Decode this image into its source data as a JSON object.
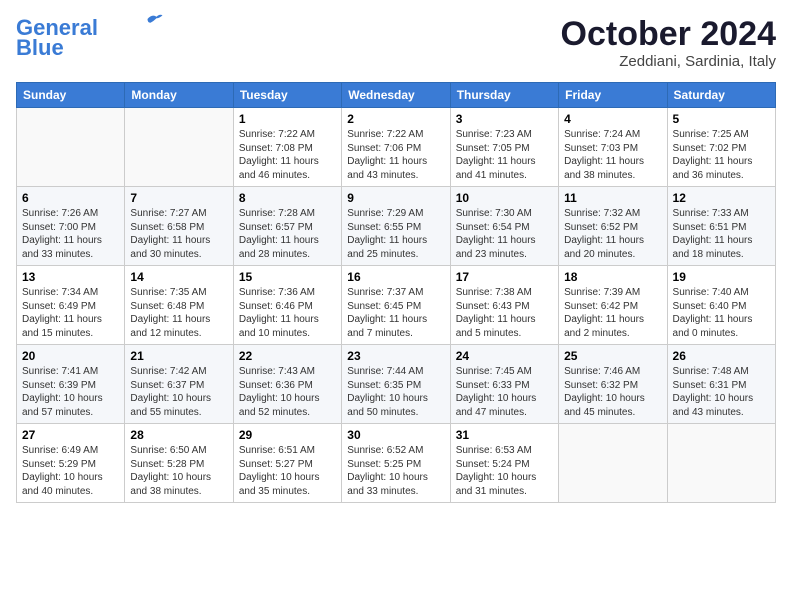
{
  "header": {
    "logo_line1": "General",
    "logo_line2": "Blue",
    "month": "October 2024",
    "location": "Zeddiani, Sardinia, Italy"
  },
  "days_of_week": [
    "Sunday",
    "Monday",
    "Tuesday",
    "Wednesday",
    "Thursday",
    "Friday",
    "Saturday"
  ],
  "weeks": [
    [
      {
        "day": "",
        "info": ""
      },
      {
        "day": "",
        "info": ""
      },
      {
        "day": "1",
        "info": "Sunrise: 7:22 AM\nSunset: 7:08 PM\nDaylight: 11 hours and 46 minutes."
      },
      {
        "day": "2",
        "info": "Sunrise: 7:22 AM\nSunset: 7:06 PM\nDaylight: 11 hours and 43 minutes."
      },
      {
        "day": "3",
        "info": "Sunrise: 7:23 AM\nSunset: 7:05 PM\nDaylight: 11 hours and 41 minutes."
      },
      {
        "day": "4",
        "info": "Sunrise: 7:24 AM\nSunset: 7:03 PM\nDaylight: 11 hours and 38 minutes."
      },
      {
        "day": "5",
        "info": "Sunrise: 7:25 AM\nSunset: 7:02 PM\nDaylight: 11 hours and 36 minutes."
      }
    ],
    [
      {
        "day": "6",
        "info": "Sunrise: 7:26 AM\nSunset: 7:00 PM\nDaylight: 11 hours and 33 minutes."
      },
      {
        "day": "7",
        "info": "Sunrise: 7:27 AM\nSunset: 6:58 PM\nDaylight: 11 hours and 30 minutes."
      },
      {
        "day": "8",
        "info": "Sunrise: 7:28 AM\nSunset: 6:57 PM\nDaylight: 11 hours and 28 minutes."
      },
      {
        "day": "9",
        "info": "Sunrise: 7:29 AM\nSunset: 6:55 PM\nDaylight: 11 hours and 25 minutes."
      },
      {
        "day": "10",
        "info": "Sunrise: 7:30 AM\nSunset: 6:54 PM\nDaylight: 11 hours and 23 minutes."
      },
      {
        "day": "11",
        "info": "Sunrise: 7:32 AM\nSunset: 6:52 PM\nDaylight: 11 hours and 20 minutes."
      },
      {
        "day": "12",
        "info": "Sunrise: 7:33 AM\nSunset: 6:51 PM\nDaylight: 11 hours and 18 minutes."
      }
    ],
    [
      {
        "day": "13",
        "info": "Sunrise: 7:34 AM\nSunset: 6:49 PM\nDaylight: 11 hours and 15 minutes."
      },
      {
        "day": "14",
        "info": "Sunrise: 7:35 AM\nSunset: 6:48 PM\nDaylight: 11 hours and 12 minutes."
      },
      {
        "day": "15",
        "info": "Sunrise: 7:36 AM\nSunset: 6:46 PM\nDaylight: 11 hours and 10 minutes."
      },
      {
        "day": "16",
        "info": "Sunrise: 7:37 AM\nSunset: 6:45 PM\nDaylight: 11 hours and 7 minutes."
      },
      {
        "day": "17",
        "info": "Sunrise: 7:38 AM\nSunset: 6:43 PM\nDaylight: 11 hours and 5 minutes."
      },
      {
        "day": "18",
        "info": "Sunrise: 7:39 AM\nSunset: 6:42 PM\nDaylight: 11 hours and 2 minutes."
      },
      {
        "day": "19",
        "info": "Sunrise: 7:40 AM\nSunset: 6:40 PM\nDaylight: 11 hours and 0 minutes."
      }
    ],
    [
      {
        "day": "20",
        "info": "Sunrise: 7:41 AM\nSunset: 6:39 PM\nDaylight: 10 hours and 57 minutes."
      },
      {
        "day": "21",
        "info": "Sunrise: 7:42 AM\nSunset: 6:37 PM\nDaylight: 10 hours and 55 minutes."
      },
      {
        "day": "22",
        "info": "Sunrise: 7:43 AM\nSunset: 6:36 PM\nDaylight: 10 hours and 52 minutes."
      },
      {
        "day": "23",
        "info": "Sunrise: 7:44 AM\nSunset: 6:35 PM\nDaylight: 10 hours and 50 minutes."
      },
      {
        "day": "24",
        "info": "Sunrise: 7:45 AM\nSunset: 6:33 PM\nDaylight: 10 hours and 47 minutes."
      },
      {
        "day": "25",
        "info": "Sunrise: 7:46 AM\nSunset: 6:32 PM\nDaylight: 10 hours and 45 minutes."
      },
      {
        "day": "26",
        "info": "Sunrise: 7:48 AM\nSunset: 6:31 PM\nDaylight: 10 hours and 43 minutes."
      }
    ],
    [
      {
        "day": "27",
        "info": "Sunrise: 6:49 AM\nSunset: 5:29 PM\nDaylight: 10 hours and 40 minutes."
      },
      {
        "day": "28",
        "info": "Sunrise: 6:50 AM\nSunset: 5:28 PM\nDaylight: 10 hours and 38 minutes."
      },
      {
        "day": "29",
        "info": "Sunrise: 6:51 AM\nSunset: 5:27 PM\nDaylight: 10 hours and 35 minutes."
      },
      {
        "day": "30",
        "info": "Sunrise: 6:52 AM\nSunset: 5:25 PM\nDaylight: 10 hours and 33 minutes."
      },
      {
        "day": "31",
        "info": "Sunrise: 6:53 AM\nSunset: 5:24 PM\nDaylight: 10 hours and 31 minutes."
      },
      {
        "day": "",
        "info": ""
      },
      {
        "day": "",
        "info": ""
      }
    ]
  ]
}
